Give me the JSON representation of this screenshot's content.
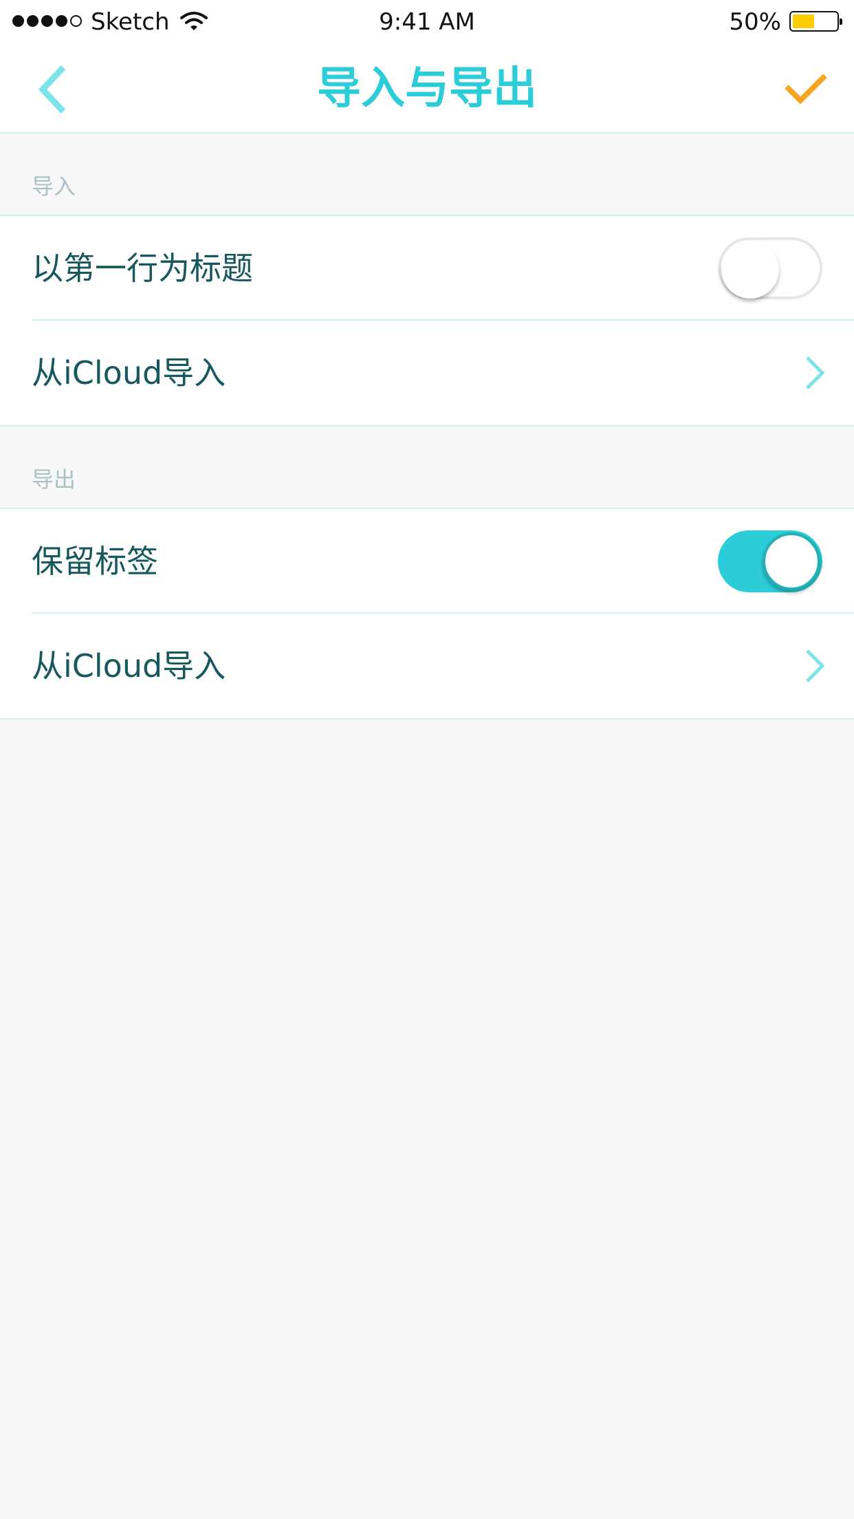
{
  "status_bar": {
    "carrier": "Sketch",
    "time": "9:41 AM",
    "battery_percent": "50%",
    "battery_level": 0.5,
    "battery_color": "#ffcc00",
    "signal_bars": 4,
    "signal_total": 5
  },
  "nav": {
    "title": "导入与导出",
    "title_color": "#2ccdd8",
    "back_icon": "chevron-left-icon",
    "back_color": "#7de3ea",
    "confirm_icon": "checkmark-icon",
    "confirm_color": "#f5a623"
  },
  "sections": {
    "import": {
      "header": "导入",
      "rows": [
        {
          "label": "以第一行为标题",
          "control": "toggle",
          "on": false
        },
        {
          "label": "从iCloud导入",
          "control": "chevron"
        }
      ]
    },
    "export": {
      "header": "导出",
      "rows": [
        {
          "label": "保留标签",
          "control": "toggle",
          "on": true
        },
        {
          "label": "从iCloud导入",
          "control": "chevron"
        }
      ]
    }
  },
  "colors": {
    "accent": "#2ccdd8",
    "label_text": "#17585e",
    "section_header_text": "#a9c2c5",
    "divider": "#cfeff2",
    "background": "#f8f8f8"
  }
}
